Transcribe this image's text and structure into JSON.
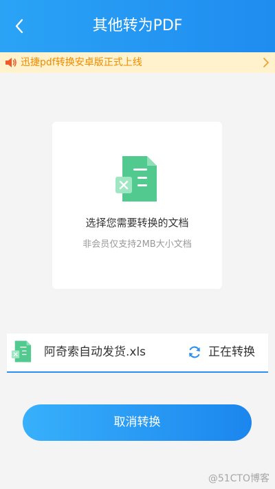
{
  "header": {
    "title": "其他转为PDF"
  },
  "notice": {
    "text": "迅捷pdf转换安卓版正式上线"
  },
  "upload_card": {
    "title": "选择您需要转换的文档",
    "subtitle": "非会员仅支持2MB大小文档"
  },
  "file": {
    "name": "阿奇索自动发货.xls",
    "status": "正在转换"
  },
  "actions": {
    "cancel_label": "取消转换"
  },
  "watermark": {
    "text": "@51CTO博客"
  },
  "colors": {
    "header_blue": "#1f8cf0",
    "notice_bg": "#fff2cc",
    "notice_text": "#f08a00",
    "excel_green": "#52c98e",
    "button_blue": "#2a8ff0"
  },
  "icons": {
    "back": "chevron-left-icon",
    "notice": "speaker-icon",
    "notice_arrow": "chevron-right-icon",
    "file": "excel-file-icon",
    "status": "refresh-icon"
  }
}
